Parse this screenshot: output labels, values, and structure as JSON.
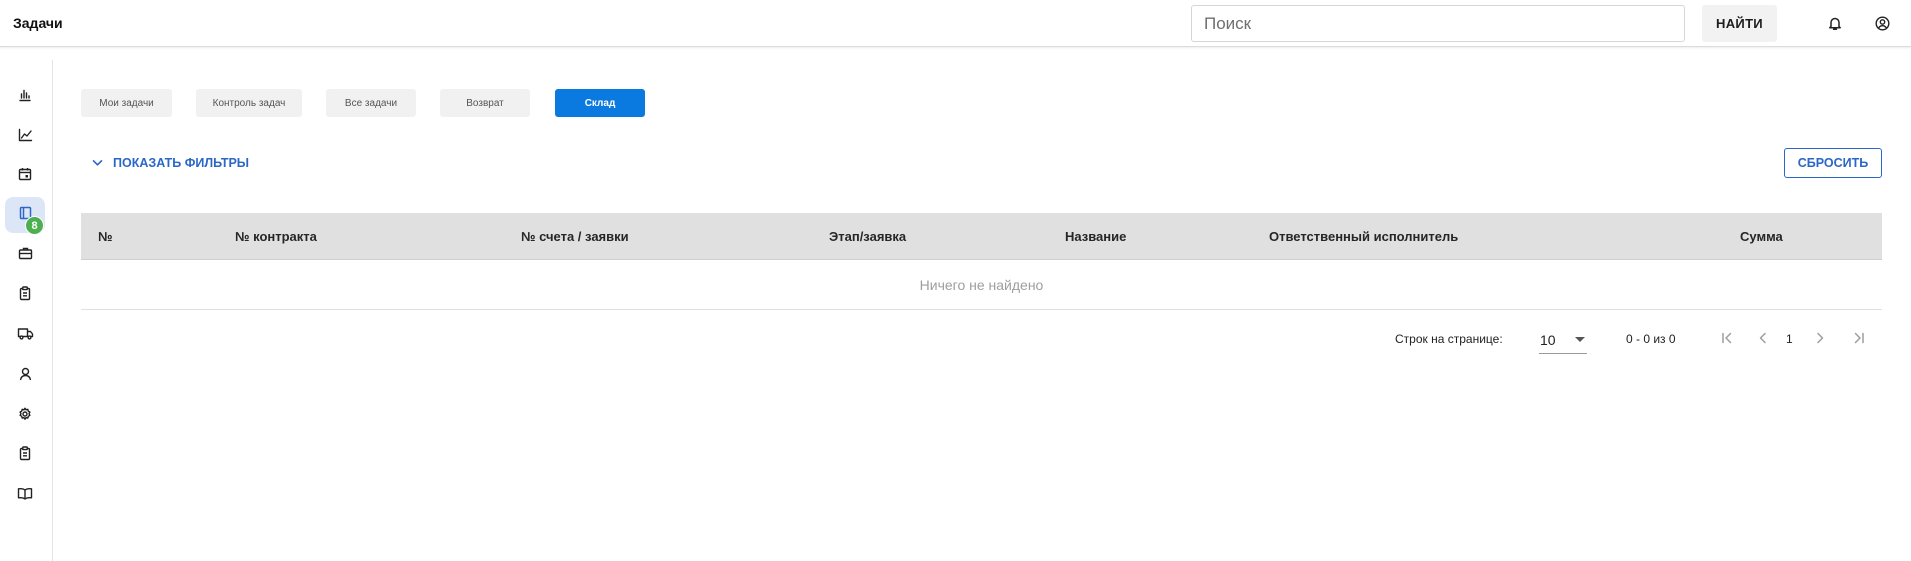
{
  "header": {
    "title": "Задачи",
    "search_placeholder": "Поиск",
    "find_label": "НАЙТИ"
  },
  "sidebar": {
    "items": [
      {
        "icon": "bar-chart-icon"
      },
      {
        "icon": "line-chart-icon"
      },
      {
        "icon": "calendar-icon"
      },
      {
        "icon": "book-icon",
        "active": true,
        "badge": "8"
      },
      {
        "icon": "briefcase-icon"
      },
      {
        "icon": "clipboard-icon"
      },
      {
        "icon": "truck-icon"
      },
      {
        "icon": "user-icon"
      },
      {
        "icon": "gear-icon"
      },
      {
        "icon": "clipboard-icon"
      },
      {
        "icon": "open-book-icon"
      }
    ],
    "badge": "8"
  },
  "tabs": [
    {
      "label": "Мои задачи"
    },
    {
      "label": "Контроль задач"
    },
    {
      "label": "Все задачи"
    },
    {
      "label": "Возврат"
    },
    {
      "label": "Склад",
      "active": true
    }
  ],
  "filters": {
    "toggle_label": "ПОКАЗАТЬ ФИЛЬТРЫ",
    "reset_label": "СБРОСИТЬ"
  },
  "table": {
    "columns": [
      "№",
      "№ контракта",
      "№ счета / заявки",
      "Этап/заявка",
      "Название",
      "Ответственный исполнитель",
      "Сумма"
    ],
    "empty_text": "Ничего не найдено"
  },
  "pagination": {
    "rows_label": "Строк на странице:",
    "rows_value": "10",
    "range": "0 - 0 из 0",
    "page": "1"
  },
  "colors": {
    "accent": "#0a7ae0",
    "link": "#2a67c7",
    "badge": "#4caf50",
    "header_bg": "#e0e0e0"
  }
}
